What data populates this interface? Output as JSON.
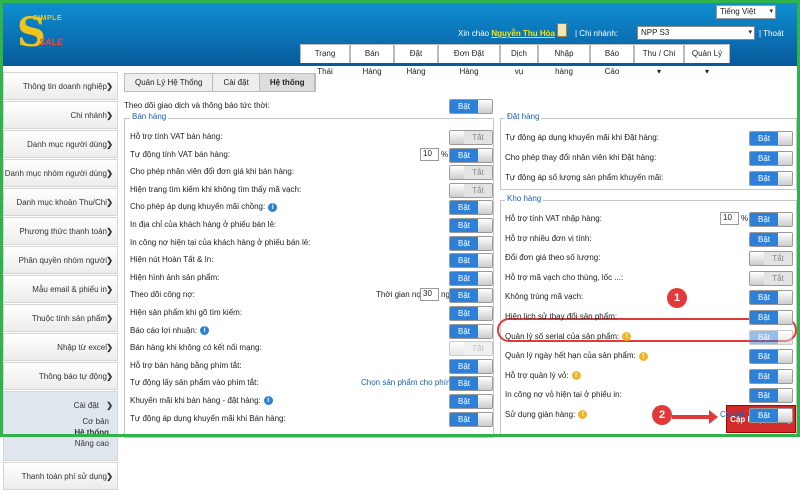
{
  "header": {
    "logo_top": "SIMPLE",
    "logo_letter": "S",
    "logo_bottom": "SALE",
    "language": "Tiếng Việt",
    "greeting": "Xin chào",
    "user": "Nguyễn Thu Hòa",
    "branch_label": "| Chi nhánh:",
    "branch_value": "NPP S3",
    "logout": "| Thoát"
  },
  "tabs": [
    "Trạng Thái",
    "Bán Hàng",
    "Đặt Hàng",
    "Đơn Đặt Hàng",
    "Dịch vụ",
    "Nhập hàng",
    "Báo Cáo",
    "Thu / Chi ▾",
    "Quản Lý ▾"
  ],
  "sidebar": {
    "items": [
      "Thông tin doanh nghiệp",
      "Chi nhánh",
      "Danh mục người dùng",
      "Danh mục nhóm người dùng",
      "Danh mục khoản Thu/Chi",
      "Phương thức thanh toán",
      "Phân quyền nhóm người dùng",
      "Mẫu email & phiếu in",
      "Thuộc tính sản phẩm",
      "Nhập từ excel",
      "Thông báo tự động",
      "Cài đặt",
      "Thanh toán phí sử dụng"
    ],
    "subitems": [
      "Cơ bản",
      "Hệ thống",
      "Nâng cao"
    ]
  },
  "breadcrumb": [
    "Quản Lý Hệ Thống",
    "Cài đặt",
    "Hệ thống"
  ],
  "top_setting": {
    "label": "Theo dõi giao dịch và thông báo tức thời:",
    "state": "Bật"
  },
  "sales": {
    "title": "Bán hàng",
    "rows": [
      {
        "label": "Hỗ trợ tính VAT bán hàng:",
        "state": "Tắt"
      },
      {
        "label": "Tự động tính VAT bán hàng:",
        "state": "Bật",
        "num": "10",
        "unit": "%"
      },
      {
        "label": "Cho phép nhân viên đổi đơn giá khi bán hàng:",
        "state": "Tắt"
      },
      {
        "label": "Hiện trang tìm kiếm khi không tìm thấy mã vạch:",
        "state": "Tắt"
      },
      {
        "label": "Cho phép áp dụng khuyến mãi chồng:",
        "state": "Bật",
        "icon": "info"
      },
      {
        "label": "In địa chỉ của khách hàng ở phiếu bán lẻ:",
        "state": "Bật"
      },
      {
        "label": "In công nợ hiện tại của khách hàng ở phiếu bán lẻ:",
        "state": "Bật"
      },
      {
        "label": "Hiện nút Hoàn Tất & In:",
        "state": "Bật"
      },
      {
        "label": "Hiện hình ảnh sản phẩm:",
        "state": "Bật"
      },
      {
        "label": "Theo dõi công nợ:",
        "state": "Bật",
        "extra": "Thời gian nợ:",
        "num": "30",
        "unit": "ngày"
      },
      {
        "label": "Hiện sản phẩm khi gõ tìm kiếm:",
        "state": "Bật"
      },
      {
        "label": "Báo cáo lợi nhuận:",
        "state": "Bật",
        "icon": "info"
      },
      {
        "label": "Bán hàng khi không có kết nối mạng:",
        "state": "Tắt",
        "disabled": true
      },
      {
        "label": "Hỗ trợ bán hàng bằng phím tắt:",
        "state": "Bật"
      },
      {
        "label": "Tự động lấy sản phẩm vào phím tắt:",
        "state": "Bật",
        "link": "Chọn sản phẩm cho phím tắt"
      },
      {
        "label": "Khuyến mãi khi bán hàng - đặt hàng:",
        "state": "Bật",
        "icon": "info"
      },
      {
        "label": "Tự động áp dụng khuyến mãi khi Bán hàng:",
        "state": "Bật"
      }
    ]
  },
  "order": {
    "title": "Đặt hàng",
    "rows": [
      {
        "label": "Tự động áp dụng khuyến mãi khi Đặt hàng:",
        "state": "Bật"
      },
      {
        "label": "Cho phép thay đổi nhân viên khi Đặt hàng:",
        "state": "Bật"
      },
      {
        "label": "Tự động áp số lượng sản phẩm khuyến mãi:",
        "state": "Bật"
      }
    ]
  },
  "warehouse": {
    "title": "Kho hàng",
    "rows": [
      {
        "label": "Hỗ trợ tính VAT nhập hàng:",
        "state": "Bật",
        "num": "10",
        "unit": "%"
      },
      {
        "label": "Hỗ trợ nhiều đơn vị tính:",
        "state": "Bật"
      },
      {
        "label": "Đổi đơn giá theo số lượng:",
        "state": "Tắt"
      },
      {
        "label": "Hỗ trợ mã vạch cho thùng, lốc ...:",
        "state": "Tắt"
      },
      {
        "label": "Không trùng mã vạch:",
        "state": "Bật"
      },
      {
        "label": "Hiện lịch sử thay đổi sản phẩm:",
        "state": "Bật"
      },
      {
        "label": "Quản lý số serial của sản phẩm:",
        "state": "Bật",
        "icon": "warn",
        "disabled": true
      },
      {
        "label": "Quản lý ngày hết hạn của sản phẩm:",
        "state": "Bật",
        "icon": "warn"
      },
      {
        "label": "Hỗ trợ quản lý vỏ:",
        "state": "Bật",
        "icon": "warn"
      },
      {
        "label": "In công nợ vỏ hiện tại ở phiếu in:",
        "state": "Bật"
      },
      {
        "label": "Sử dụng giàn hàng:",
        "state": "Bật",
        "icon": "warn",
        "link": "Chi tiết"
      }
    ]
  },
  "annotations": {
    "badge1": "1",
    "badge2": "2"
  },
  "save_button": "Cập Nhật Thông Tin",
  "colors": {
    "accent": "#2d7fd8",
    "highlight": "#e23a3a",
    "frame": "#2fb34a"
  }
}
